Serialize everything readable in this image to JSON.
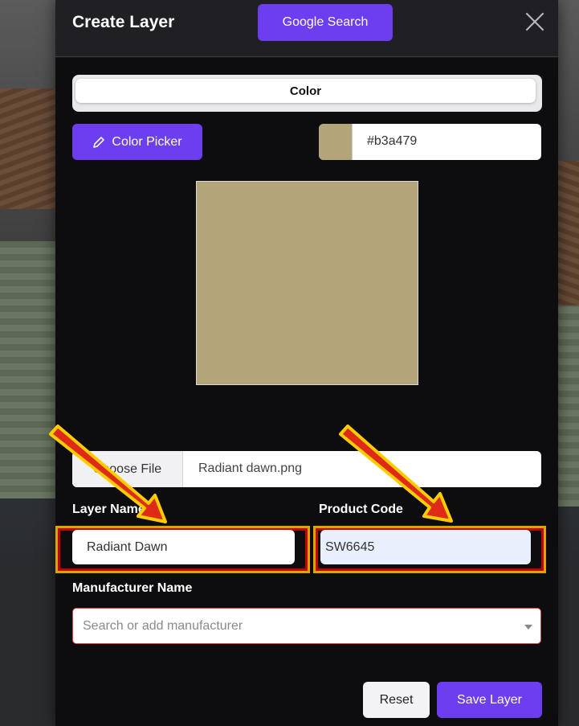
{
  "header": {
    "title": "Create Layer",
    "google_search_label": "Google Search"
  },
  "tabs": {
    "active": "Color"
  },
  "color_picker": {
    "button_label": "Color Picker",
    "hex_value": "#b3a479",
    "swatch_color": "#b3a479"
  },
  "file": {
    "choose_label": "Choose File",
    "file_name": "Radiant dawn.png"
  },
  "fields": {
    "layer_name_label": "Layer Name",
    "layer_name_value": "Radiant Dawn",
    "product_code_label": "Product Code",
    "product_code_value": "SW6645",
    "manufacturer_label": "Manufacturer Name",
    "manufacturer_placeholder": "Search or add manufacturer"
  },
  "actions": {
    "reset_label": "Reset",
    "save_label": "Save Layer"
  },
  "colors": {
    "accent": "#6c3ef0",
    "highlight_outer": "#d7a700",
    "highlight_inner": "#c40000",
    "arrow": "#e02a18"
  }
}
